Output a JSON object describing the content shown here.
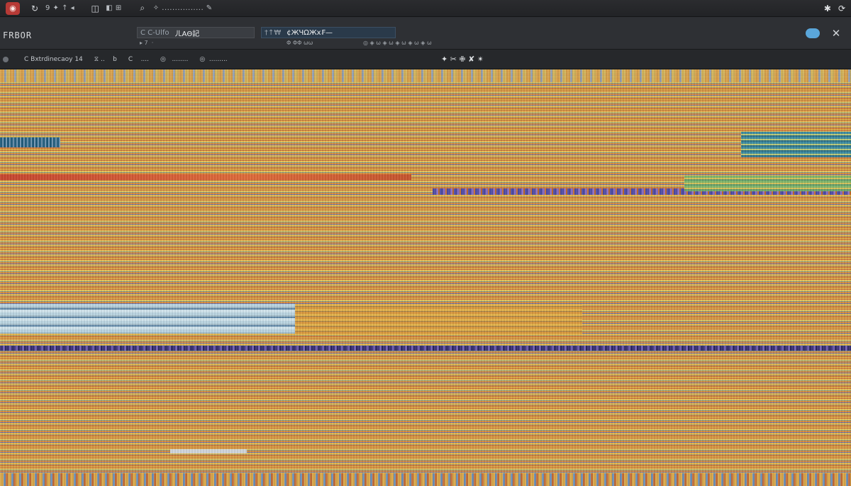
{
  "topbar": {
    "app_icon": "app-logo-icon",
    "group_a_label": "9 ✦ ↑ ◂",
    "group_b_label": "◧ ⊞",
    "group_c_label": "✧ ................ ✎",
    "right_icons": [
      "bug-icon",
      "refresh-icon"
    ]
  },
  "addrbar": {
    "title": "FRBOR",
    "cell_a_key": "C  C-Ul­fo",
    "cell_a_value": "ㄦΑΘ記",
    "cell_b_key": "†↑₩",
    "cell_b_value": "¢ЖЧΩЖх₣—",
    "sub_a": "▸ 7  ·",
    "sub_b": "Φ ΦΦ ωω",
    "sub_c": "◎ ◈ ω ◈ ω ◈ ω ◈ ω ◈ ω"
  },
  "toolbar": {
    "tool_1": "C Bxtrdinecaoy 14",
    "tool_2": "⧖ ..    b",
    "tool_3": "C    ....",
    "tool_4": "◎   ........",
    "tool_5": "◎  .........",
    "center": "✦ ✂ ✙ ✘ ✴"
  },
  "colors": {
    "app_icon_bg": "#b73a36",
    "accent_blue": "#5aa6da"
  }
}
